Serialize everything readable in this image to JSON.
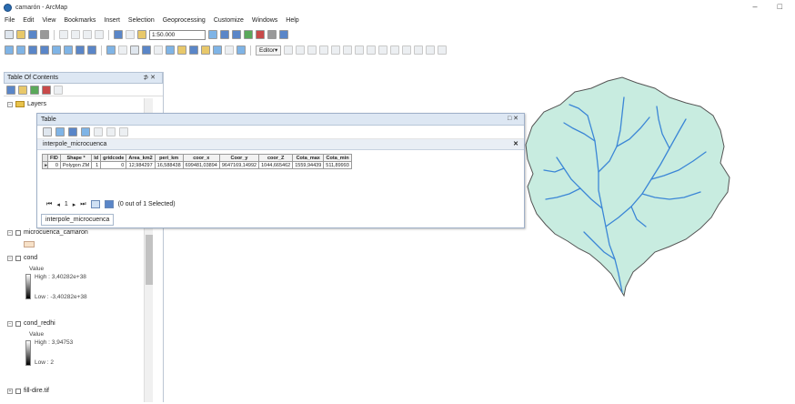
{
  "window": {
    "title": "camarón - ArcMap",
    "minimize": "–",
    "maximize": "□"
  },
  "menu": [
    "File",
    "Edit",
    "View",
    "Bookmarks",
    "Insert",
    "Selection",
    "Geoprocessing",
    "Customize",
    "Windows",
    "Help"
  ],
  "toolbar": {
    "scale": "1:50.000",
    "editor": "Editor▾"
  },
  "toc": {
    "title": "Table Of Contents",
    "pin": "⊅ ✕",
    "layers_group": "Layers",
    "layers": [
      {
        "name": "microcuenca_camaron"
      },
      {
        "name": "cond",
        "value_label": "Value",
        "high": "High : 3,40282e+38",
        "low": "Low : -3,40282e+38"
      },
      {
        "name": "cond_redhi",
        "value_label": "Value",
        "high": "High : 3,94753",
        "low": "Low : 2"
      },
      {
        "name": "fill-dire.tif"
      }
    ]
  },
  "table_window": {
    "title": "Table",
    "close": "□ ✕",
    "tab_name": "interpole_microcuenca",
    "tab_close": "✕",
    "columns": [
      "FID",
      "Shape *",
      "Id",
      "gridcode",
      "Area_km2",
      "peri_km",
      "coor_x",
      "Coor_y",
      "coor_Z",
      "Cota_max",
      "Cota_min"
    ],
    "rows": [
      [
        "0",
        "Polygon ZM",
        "1",
        "0",
        "12,984297",
        "16,588438",
        "699481,03894",
        "9647169,14992",
        "1044,665462",
        "1559,94439",
        "511,89993"
      ]
    ],
    "record": "1",
    "selection": "(0 out of 1 Selected)",
    "bottom_tab": "interpole_microcuenca"
  },
  "colors": {
    "watershed_fill": "#c8ece0",
    "stream": "#3b86d6",
    "boundary": "#555555"
  }
}
